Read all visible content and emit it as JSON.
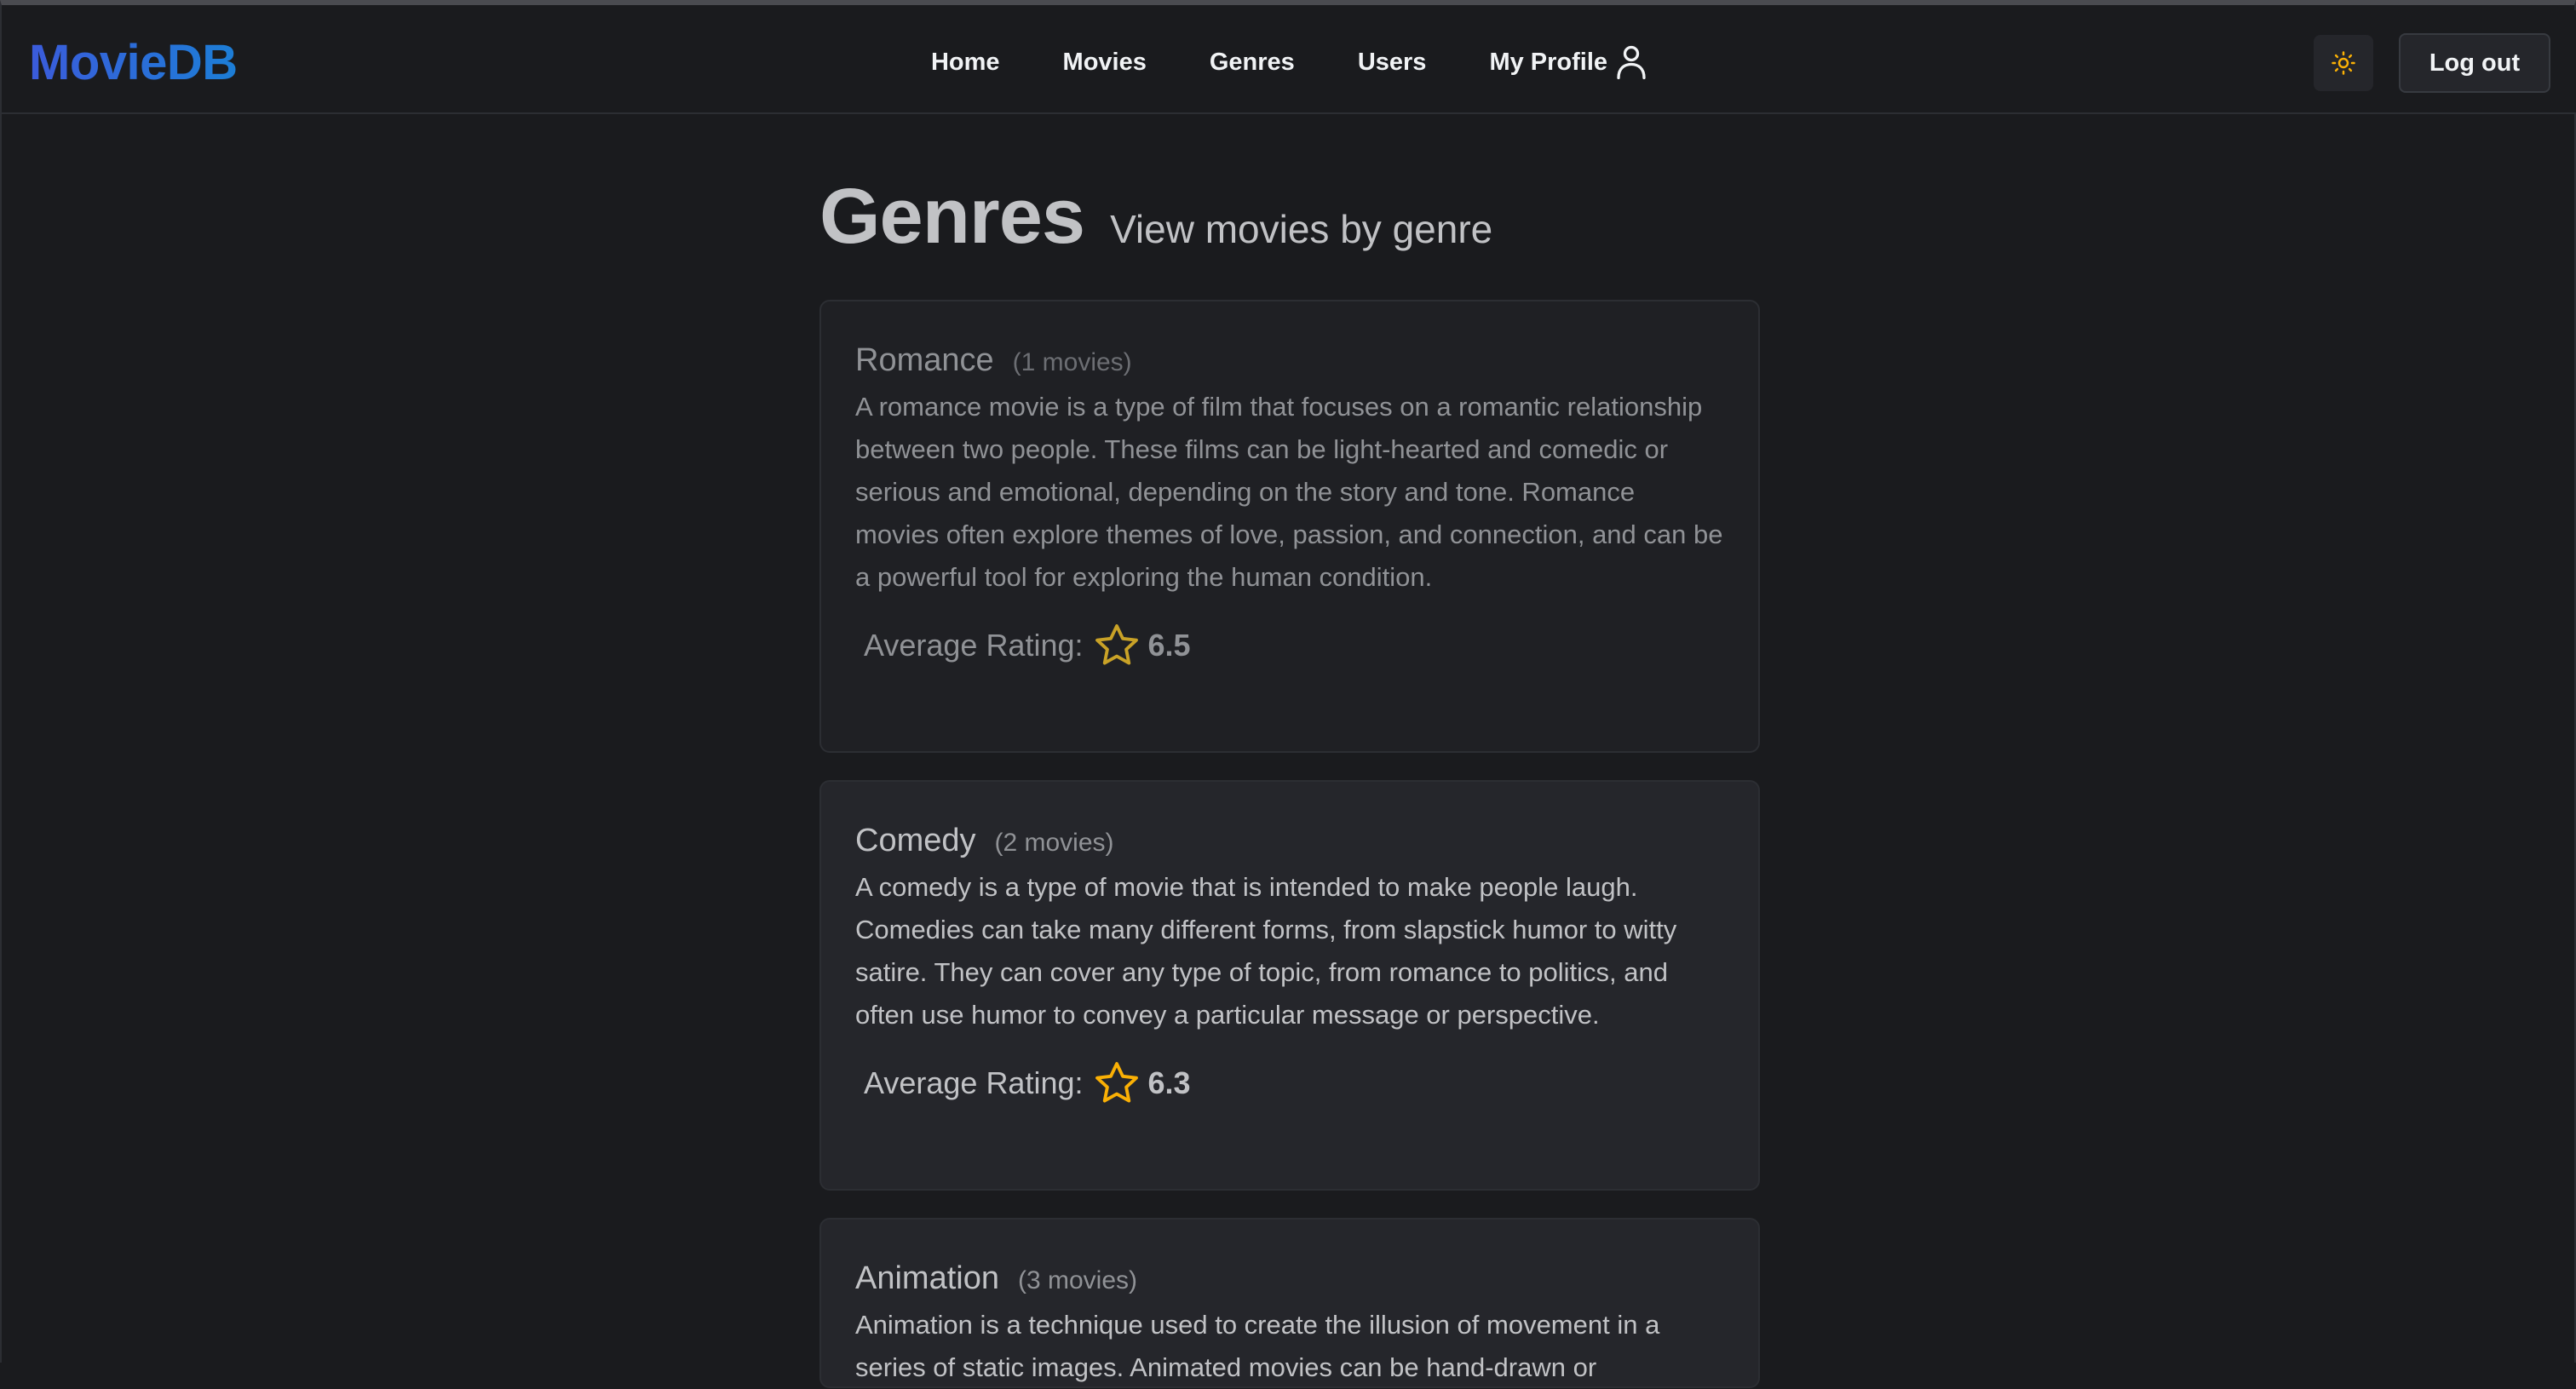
{
  "app": {
    "logo": "MovieDB"
  },
  "nav": {
    "items": [
      {
        "label": "Home"
      },
      {
        "label": "Movies"
      },
      {
        "label": "Genres"
      },
      {
        "label": "Users"
      },
      {
        "label": "My Profile",
        "icon": "user-icon"
      }
    ],
    "theme_toggle_icon": "sun-icon",
    "logout_label": "Log out"
  },
  "page": {
    "title": "Genres",
    "subtitle": "View movies by genre"
  },
  "genres": [
    {
      "name": "Romance",
      "count": "(1 movies)",
      "description": "A romance movie is a type of film that focuses on a romantic relationship between two people. These films can be light-hearted and comedic or serious and emotional, depending on the story and tone. Romance movies often explore themes of love, passion, and connection, and can be a powerful tool for exploring the human condition.",
      "rating_label": "Average Rating:",
      "rating": "6.5"
    },
    {
      "name": "Comedy",
      "count": "(2 movies)",
      "description": "A comedy is a type of movie that is intended to make people laugh. Comedies can take many different forms, from slapstick humor to witty satire. They can cover any type of topic, from romance to politics, and often use humor to convey a particular message or perspective.",
      "rating_label": "Average Rating:",
      "rating": "6.3"
    },
    {
      "name": "Animation",
      "count": "(3 movies)",
      "description": "Animation is a technique used to create the illusion of movement in a series of static images. Animated movies can be hand-drawn or"
    }
  ],
  "colors": {
    "background": "#1a1b1e",
    "card": "#25262b",
    "accent_star": "#fab005",
    "logo_gradient_start": "#3b5bdb",
    "logo_gradient_end": "#1c7ed6"
  }
}
